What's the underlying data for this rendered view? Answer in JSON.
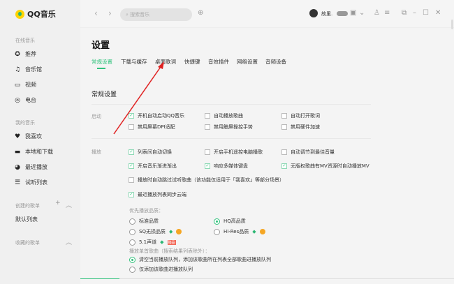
{
  "app": {
    "name": "QQ音乐"
  },
  "sidebar": {
    "online_title": "在线音乐",
    "online": [
      {
        "label": "推荐",
        "icon": "star-circle-icon"
      },
      {
        "label": "音乐馆",
        "icon": "music-note-icon"
      },
      {
        "label": "视频",
        "icon": "video-icon"
      },
      {
        "label": "电台",
        "icon": "radio-icon"
      }
    ],
    "my_title": "我的音乐",
    "my": [
      {
        "label": "我喜欢",
        "icon": "heart-icon"
      },
      {
        "label": "本地和下载",
        "icon": "monitor-icon"
      },
      {
        "label": "最近播放",
        "icon": "clock-icon"
      },
      {
        "label": "试听列表",
        "icon": "playlist-icon"
      }
    ],
    "created_title": "创建的歌单",
    "created": [
      "默认列表"
    ],
    "collected_title": "收藏的歌单"
  },
  "topbar": {
    "search_placeholder": "搜索音乐",
    "username": "故里."
  },
  "settings": {
    "title": "设置",
    "tabs": [
      "常规设置",
      "下载与缓存",
      "桌面歌词",
      "快捷键",
      "音效插件",
      "网络设置",
      "音频设备"
    ],
    "section": "常规设置",
    "startup_label": "启动",
    "startup": [
      {
        "label": "开机自动启动QQ音乐",
        "checked": true
      },
      {
        "label": "自动播放歌曲",
        "checked": false
      },
      {
        "label": "自动打开歌词",
        "checked": false
      },
      {
        "label": "禁用屏幕DPI适配",
        "checked": false
      },
      {
        "label": "禁用触屏操控手势",
        "checked": false
      },
      {
        "label": "禁用硬件加速",
        "checked": false
      }
    ],
    "play_label": "播放",
    "play": [
      {
        "label": "列表间自动切换",
        "checked": true
      },
      {
        "label": "开启手机遥控电脑播歌",
        "checked": false
      },
      {
        "label": "自动调节到最佳音量",
        "checked": false
      },
      {
        "label": "开启音乐渐进渐出",
        "checked": true
      },
      {
        "label": "响应多媒体键盘",
        "checked": true
      },
      {
        "label": "无版权歌曲有MV资源时自动播放MV",
        "checked": true
      },
      {
        "label": "播放时自动跳过试听歌曲（该功能仅适用于「我喜欢」等部分场景）",
        "checked": false
      },
      {
        "label": "最近播放列表同步云端",
        "checked": true
      }
    ],
    "quality_title": "优先播放品质：",
    "quality": [
      {
        "label": "标准品质",
        "selected": false
      },
      {
        "label": "HQ高品质",
        "selected": true
      },
      {
        "label": "SQ无损品质",
        "selected": false
      },
      {
        "label": "Hi-Res品质",
        "selected": false
      },
      {
        "label": "5.1声道",
        "selected": false,
        "badge": "臻品"
      }
    ],
    "single_title": "播放单首歌曲（搜索结果列表除外）：",
    "single": [
      {
        "label": "清空当前播放队列，添加该歌曲所在列表全部歌曲进播放队列",
        "selected": true
      },
      {
        "label": "仅添加该歌曲进播放队列",
        "selected": false
      }
    ]
  },
  "colors": {
    "accent": "#31c27c",
    "arrow": "#e02020"
  }
}
